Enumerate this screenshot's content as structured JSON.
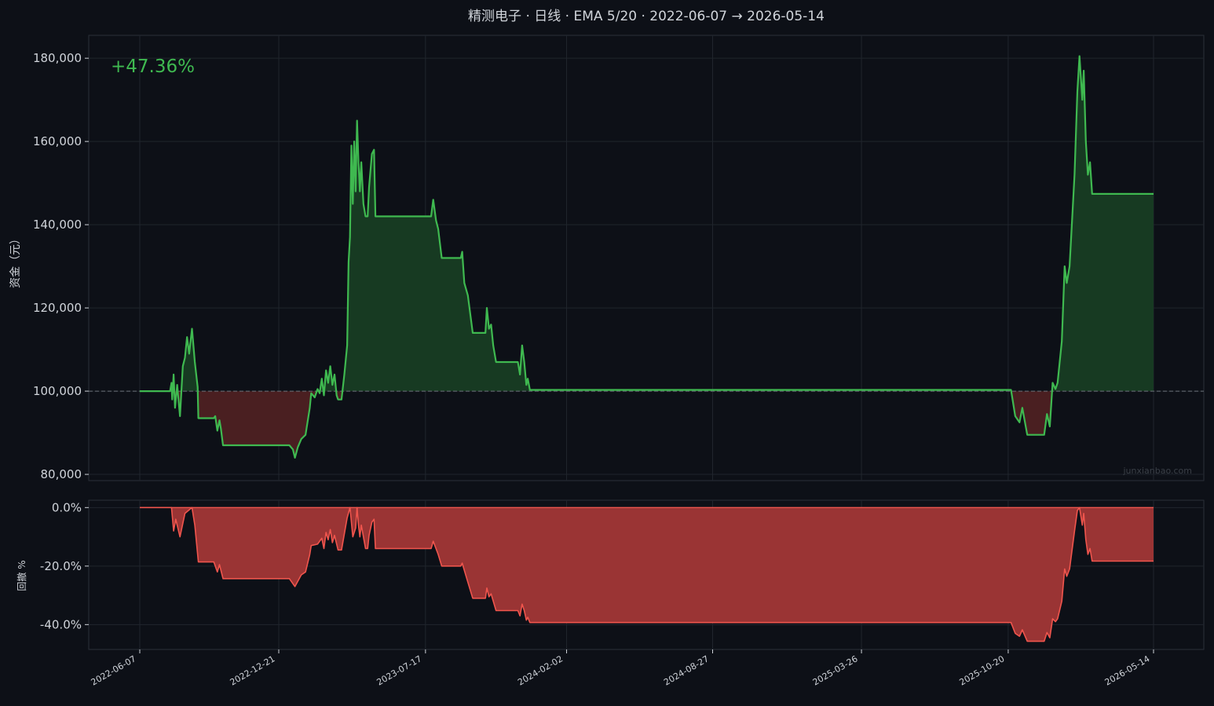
{
  "title": "精测电子 · 日线 · EMA 5/20 · 2022-06-07 → 2026-05-14",
  "return_label": "+47.36%",
  "watermark": "junxianbao.com",
  "colors": {
    "background": "#0d1017",
    "panel_border": "#2a2f38",
    "grid": "#20252d",
    "text": "#d0d4da",
    "equity_line": "#3fb950",
    "gain_fill": "#173a22",
    "loss_fill": "#4a1f21",
    "drawdown_line": "#f0554d",
    "drawdown_fill": "#9a3434",
    "baseline": "#6b7079"
  },
  "chart_data": [
    {
      "type": "line",
      "name": "equity",
      "ylabel": "资金（元）",
      "ylim": [
        78500,
        185500
      ],
      "yticks": [
        80000,
        100000,
        120000,
        140000,
        160000,
        180000
      ],
      "ytick_labels": [
        "80,000",
        "100,000",
        "120,000",
        "140,000",
        "160,000",
        "180,000"
      ],
      "baseline": 100000,
      "x_dates": [
        "2022-06-07",
        "2022-12-21",
        "2023-07-17",
        "2024-02-02",
        "2024-08-27",
        "2025-03-26",
        "2025-10-20",
        "2026-05-14"
      ],
      "grid": true,
      "points": [
        [
          "2022-06-07",
          100000
        ],
        [
          "2022-07-20",
          100000
        ],
        [
          "2022-07-22",
          102000
        ],
        [
          "2022-07-23",
          98000
        ],
        [
          "2022-07-25",
          104000
        ],
        [
          "2022-07-27",
          96000
        ],
        [
          "2022-07-30",
          101500
        ],
        [
          "2022-08-03",
          94000
        ],
        [
          "2022-08-07",
          106000
        ],
        [
          "2022-08-10",
          108000
        ],
        [
          "2022-08-13",
          113000
        ],
        [
          "2022-08-16",
          109000
        ],
        [
          "2022-08-20",
          115000
        ],
        [
          "2022-08-24",
          107000
        ],
        [
          "2022-08-28",
          101000
        ],
        [
          "2022-08-29",
          93500
        ],
        [
          "2022-09-20",
          93500
        ],
        [
          "2022-09-22",
          94000
        ],
        [
          "2022-09-25",
          90500
        ],
        [
          "2022-09-28",
          93000
        ],
        [
          "2022-09-30",
          91000
        ],
        [
          "2022-10-03",
          87000
        ],
        [
          "2022-12-21",
          87000
        ],
        [
          "2023-01-05",
          87000
        ],
        [
          "2023-01-10",
          86000
        ],
        [
          "2023-01-13",
          84000
        ],
        [
          "2023-01-17",
          86500
        ],
        [
          "2023-01-22",
          88500
        ],
        [
          "2023-01-28",
          89500
        ],
        [
          "2023-02-03",
          96000
        ],
        [
          "2023-02-05",
          99500
        ],
        [
          "2023-02-10",
          98500
        ],
        [
          "2023-02-14",
          100500
        ],
        [
          "2023-02-17",
          99500
        ],
        [
          "2023-02-20",
          103000
        ],
        [
          "2023-02-23",
          99000
        ],
        [
          "2023-02-26",
          105000
        ],
        [
          "2023-03-01",
          102000
        ],
        [
          "2023-03-04",
          106000
        ],
        [
          "2023-03-07",
          101500
        ],
        [
          "2023-03-10",
          104000
        ],
        [
          "2023-03-13",
          99000
        ],
        [
          "2023-03-15",
          98000
        ],
        [
          "2023-03-20",
          98000
        ],
        [
          "2023-03-24",
          104000
        ],
        [
          "2023-03-28",
          111000
        ],
        [
          "2023-03-30",
          131000
        ],
        [
          "2023-04-01",
          137000
        ],
        [
          "2023-04-03",
          159000
        ],
        [
          "2023-04-05",
          145000
        ],
        [
          "2023-04-07",
          160000
        ],
        [
          "2023-04-09",
          148000
        ],
        [
          "2023-04-11",
          165000
        ],
        [
          "2023-04-13",
          155000
        ],
        [
          "2023-04-15",
          148000
        ],
        [
          "2023-04-17",
          155000
        ],
        [
          "2023-04-20",
          145000
        ],
        [
          "2023-04-23",
          142000
        ],
        [
          "2023-04-26",
          142000
        ],
        [
          "2023-04-28",
          149000
        ],
        [
          "2023-05-02",
          157000
        ],
        [
          "2023-05-05",
          158000
        ],
        [
          "2023-05-07",
          142000
        ],
        [
          "2023-07-17",
          142000
        ],
        [
          "2023-07-25",
          142000
        ],
        [
          "2023-07-28",
          146000
        ],
        [
          "2023-08-01",
          141000
        ],
        [
          "2023-08-04",
          139000
        ],
        [
          "2023-08-09",
          132000
        ],
        [
          "2023-09-05",
          132000
        ],
        [
          "2023-09-07",
          133500
        ],
        [
          "2023-09-10",
          126000
        ],
        [
          "2023-09-15",
          123000
        ],
        [
          "2023-09-22",
          114000
        ],
        [
          "2023-10-10",
          114000
        ],
        [
          "2023-10-12",
          120000
        ],
        [
          "2023-10-15",
          115000
        ],
        [
          "2023-10-18",
          116000
        ],
        [
          "2023-10-21",
          111000
        ],
        [
          "2023-10-25",
          107000
        ],
        [
          "2023-11-25",
          107000
        ],
        [
          "2023-11-28",
          104000
        ],
        [
          "2023-12-01",
          111000
        ],
        [
          "2023-12-04",
          107000
        ],
        [
          "2023-12-07",
          101500
        ],
        [
          "2023-12-09",
          103000
        ],
        [
          "2023-12-12",
          100300
        ],
        [
          "2024-02-02",
          100300
        ],
        [
          "2025-10-20",
          100300
        ],
        [
          "2025-10-24",
          100300
        ],
        [
          "2025-10-30",
          94000
        ],
        [
          "2025-11-05",
          92500
        ],
        [
          "2025-11-09",
          96000
        ],
        [
          "2025-11-16",
          89500
        ],
        [
          "2025-12-10",
          89500
        ],
        [
          "2025-12-14",
          94500
        ],
        [
          "2025-12-18",
          91500
        ],
        [
          "2025-12-22",
          102000
        ],
        [
          "2025-12-26",
          100500
        ],
        [
          "2025-12-29",
          102000
        ],
        [
          "2026-01-04",
          112000
        ],
        [
          "2026-01-08",
          130000
        ],
        [
          "2026-01-11",
          126000
        ],
        [
          "2026-01-15",
          130000
        ],
        [
          "2026-01-22",
          152000
        ],
        [
          "2026-01-26",
          172000
        ],
        [
          "2026-01-29",
          180500
        ],
        [
          "2026-02-02",
          170000
        ],
        [
          "2026-02-04",
          177000
        ],
        [
          "2026-02-07",
          160000
        ],
        [
          "2026-02-10",
          152000
        ],
        [
          "2026-02-13",
          155000
        ],
        [
          "2026-02-16",
          147400
        ],
        [
          "2026-05-14",
          147400
        ]
      ]
    },
    {
      "type": "area",
      "name": "drawdown",
      "ylabel": "回撤 %",
      "ylim": [
        -48.5,
        2.5
      ],
      "yticks": [
        0,
        -20,
        -40
      ],
      "ytick_labels": [
        "0.0%",
        "-20.0%",
        "-40.0%"
      ],
      "grid": true,
      "points": [
        [
          "2022-06-07",
          0
        ],
        [
          "2022-07-22",
          0
        ],
        [
          "2022-07-25",
          -8
        ],
        [
          "2022-07-28",
          -4
        ],
        [
          "2022-08-03",
          -10
        ],
        [
          "2022-08-10",
          -2
        ],
        [
          "2022-08-20",
          0
        ],
        [
          "2022-08-24",
          -6
        ],
        [
          "2022-08-29",
          -18.6
        ],
        [
          "2022-09-20",
          -18.6
        ],
        [
          "2022-09-25",
          -22
        ],
        [
          "2022-09-28",
          -19.5
        ],
        [
          "2022-10-03",
          -24.3
        ],
        [
          "2022-12-21",
          -24.3
        ],
        [
          "2023-01-05",
          -24.3
        ],
        [
          "2023-01-13",
          -27
        ],
        [
          "2023-01-22",
          -23
        ],
        [
          "2023-01-28",
          -22
        ],
        [
          "2023-02-03",
          -16
        ],
        [
          "2023-02-05",
          -13
        ],
        [
          "2023-02-14",
          -12.5
        ],
        [
          "2023-02-20",
          -10.5
        ],
        [
          "2023-02-23",
          -14
        ],
        [
          "2023-02-26",
          -8.5
        ],
        [
          "2023-03-01",
          -11
        ],
        [
          "2023-03-04",
          -7.5
        ],
        [
          "2023-03-07",
          -12
        ],
        [
          "2023-03-10",
          -9.5
        ],
        [
          "2023-03-15",
          -14.5
        ],
        [
          "2023-03-20",
          -14.5
        ],
        [
          "2023-03-28",
          -3.5
        ],
        [
          "2023-04-01",
          0
        ],
        [
          "2023-04-05",
          -10
        ],
        [
          "2023-04-09",
          -7
        ],
        [
          "2023-04-11",
          0
        ],
        [
          "2023-04-13",
          -6
        ],
        [
          "2023-04-15",
          -10
        ],
        [
          "2023-04-17",
          -6
        ],
        [
          "2023-04-23",
          -14
        ],
        [
          "2023-04-26",
          -14
        ],
        [
          "2023-04-28",
          -9.5
        ],
        [
          "2023-05-02",
          -5
        ],
        [
          "2023-05-05",
          -4
        ],
        [
          "2023-05-07",
          -14
        ],
        [
          "2023-07-25",
          -14
        ],
        [
          "2023-07-28",
          -11.5
        ],
        [
          "2023-08-04",
          -16
        ],
        [
          "2023-08-09",
          -20
        ],
        [
          "2023-09-05",
          -20
        ],
        [
          "2023-09-07",
          -19
        ],
        [
          "2023-09-15",
          -25.5
        ],
        [
          "2023-09-22",
          -31
        ],
        [
          "2023-10-10",
          -31
        ],
        [
          "2023-10-12",
          -27.5
        ],
        [
          "2023-10-15",
          -30.5
        ],
        [
          "2023-10-18",
          -29.5
        ],
        [
          "2023-10-25",
          -35.2
        ],
        [
          "2023-11-25",
          -35.2
        ],
        [
          "2023-11-28",
          -37
        ],
        [
          "2023-12-01",
          -33
        ],
        [
          "2023-12-04",
          -35.2
        ],
        [
          "2023-12-07",
          -38.5
        ],
        [
          "2023-12-09",
          -37.5
        ],
        [
          "2023-12-12",
          -39.3
        ],
        [
          "2024-02-02",
          -39.3
        ],
        [
          "2025-10-20",
          -39.3
        ],
        [
          "2025-10-24",
          -39.3
        ],
        [
          "2025-10-30",
          -43
        ],
        [
          "2025-11-05",
          -44
        ],
        [
          "2025-11-09",
          -41.8
        ],
        [
          "2025-11-16",
          -45.7
        ],
        [
          "2025-12-10",
          -45.7
        ],
        [
          "2025-12-14",
          -42.7
        ],
        [
          "2025-12-18",
          -44.5
        ],
        [
          "2025-12-22",
          -38
        ],
        [
          "2025-12-26",
          -39
        ],
        [
          "2025-12-29",
          -38
        ],
        [
          "2026-01-04",
          -32
        ],
        [
          "2026-01-08",
          -21
        ],
        [
          "2026-01-11",
          -23.5
        ],
        [
          "2026-01-15",
          -21
        ],
        [
          "2026-01-22",
          -8
        ],
        [
          "2026-01-26",
          -1
        ],
        [
          "2026-01-29",
          0
        ],
        [
          "2026-02-02",
          -6
        ],
        [
          "2026-02-04",
          -2
        ],
        [
          "2026-02-07",
          -11
        ],
        [
          "2026-02-10",
          -16
        ],
        [
          "2026-02-13",
          -14
        ],
        [
          "2026-02-16",
          -18.3
        ],
        [
          "2026-05-14",
          -18.3
        ]
      ]
    }
  ]
}
